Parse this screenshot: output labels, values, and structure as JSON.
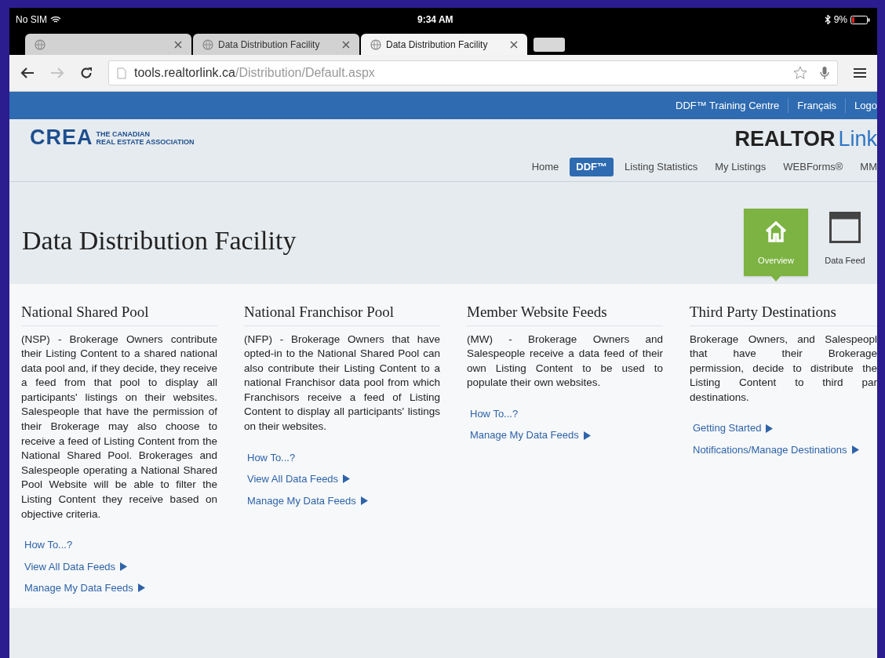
{
  "status_bar": {
    "carrier": "No SIM",
    "time": "9:34 AM",
    "battery": "9%"
  },
  "browser": {
    "tabs": [
      {
        "selected": false
      },
      {
        "title": "Data Distribution Facility",
        "selected": false
      },
      {
        "title": "Data Distribution Facility",
        "selected": true
      }
    ],
    "forward_disabled": true,
    "address": {
      "host": "tools.realtorlink.ca",
      "path": "/Distribution/Default.aspx"
    }
  },
  "utility_links": [
    "DDF™ Training Centre",
    "Français",
    "Logo"
  ],
  "logos": {
    "crea": "CREA",
    "crea_tagline": [
      "THE CANADIAN",
      "REAL ESTATE ASSOCIATION"
    ],
    "realtor": "REALTOR",
    "link": "Link"
  },
  "nav": [
    {
      "label": "Home",
      "selected": false
    },
    {
      "label": "DDF™",
      "selected": true
    },
    {
      "label": "Listing Statistics",
      "selected": false
    },
    {
      "label": "My Listings",
      "selected": false
    },
    {
      "label": "WEBForms®",
      "selected": false
    },
    {
      "label": "MM",
      "selected": false
    }
  ],
  "page_title": "Data Distribution Facility",
  "views": [
    {
      "label": "Overview",
      "kind": "home",
      "selected": true
    },
    {
      "label": "Data Feed",
      "kind": "window",
      "selected": false
    }
  ],
  "sections": [
    {
      "heading": "National Shared Pool",
      "paragraph": "(NSP) - Brokerage Owners contribute their Listing Content to a shared national data pool and, if they decide, they receive a feed from that pool to display all participants' listings on their websites.  Salespeople that have the permission of their Brokerage may also choose to receive a feed of Listing Content from the National Shared Pool.    Brokerages and Salespeople operating a National Shared Pool Website will be able to filter the Listing Content they receive based on objective criteria.",
      "links": [
        {
          "label": "How To...?",
          "arrow": false
        },
        {
          "label": "View All Data Feeds",
          "arrow": true
        },
        {
          "label": "Manage My Data Feeds",
          "arrow": true
        }
      ]
    },
    {
      "heading": "National Franchisor Pool",
      "paragraph": "(NFP) - Brokerage Owners that have opted-in to the National Shared Pool can also contribute their Listing Content to a national Franchisor data pool from which Franchisors receive a feed of Listing Content to display all participants' listings on their websites.",
      "links": [
        {
          "label": "How To...?",
          "arrow": false
        },
        {
          "label": "View All Data Feeds",
          "arrow": true
        },
        {
          "label": "Manage My Data Feeds",
          "arrow": true
        }
      ]
    },
    {
      "heading": "Member Website Feeds",
      "paragraph": "(MW) - Brokerage Owners and Salespeople receive a data feed of their own Listing Content to be used to populate their own websites.",
      "links": [
        {
          "label": "How To...?",
          "arrow": false
        },
        {
          "label": "Manage My Data Feeds",
          "arrow": true
        }
      ]
    },
    {
      "heading": "Third Party Destinations",
      "lines": [
        "Brokerage Owners, and Salespeopl",
        "that have their Brokerage",
        "permission, decide to distribute the",
        "Listing Content to third par",
        "destinations."
      ],
      "links": [
        {
          "label": "Getting Started",
          "arrow": true
        },
        {
          "label": "Notifications/Manage Destinations",
          "arrow": true
        }
      ]
    }
  ]
}
